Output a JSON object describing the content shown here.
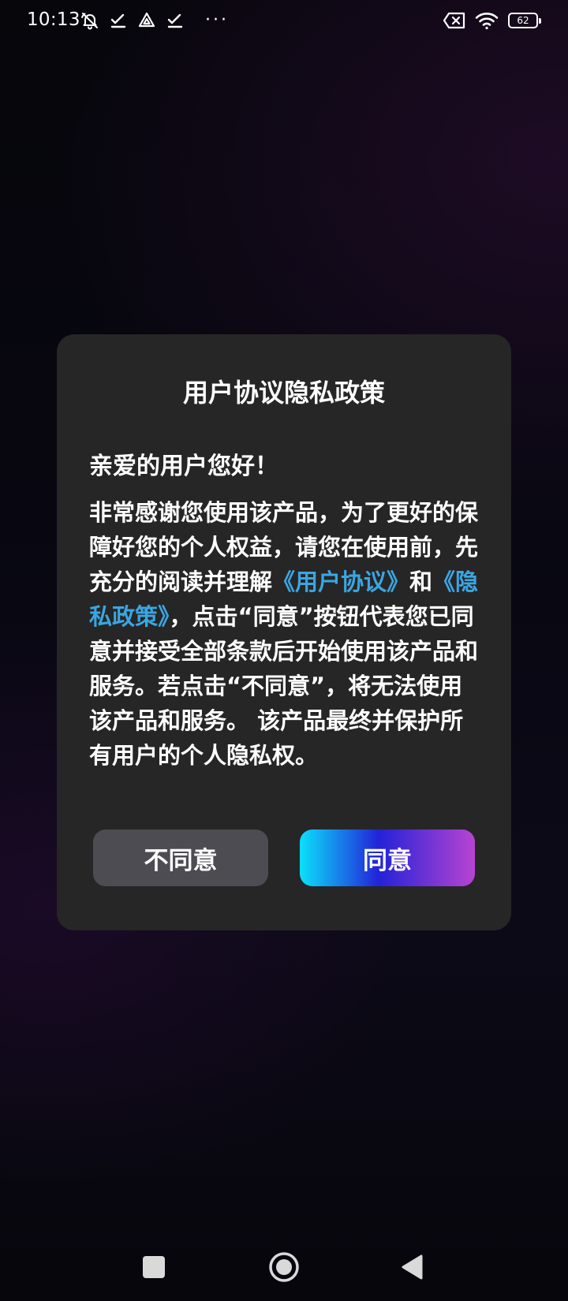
{
  "status_bar": {
    "time": "10:13",
    "more": "···",
    "battery_level": "62",
    "icons_left": [
      "muted-ring-icon",
      "check-icon",
      "cloud-triangle-icon",
      "check-icon"
    ],
    "icons_right": [
      "sim-disabled-icon",
      "wifi-icon",
      "battery-icon"
    ]
  },
  "dialog": {
    "title": "用户协议隐私政策",
    "greeting": "亲爱的用户您好！",
    "message": {
      "part1": "非常感谢您使用该产品，为了更好的保障好您的个人权益，请您在使用前，先充分的阅读并理解",
      "link_user_agreement": "《用户协议》",
      "part2": "和",
      "link_privacy_policy": "《隐私政策》",
      "part3": "，点击“同意”按钮代表您已同意并接受全部条款后开始使用该产品和服务。若点击“不同意”，将无法使用该产品和服务。 该产品最终并保护所有用户的个人隐私权。"
    },
    "disagree_label": "不同意",
    "agree_label": "同意"
  },
  "colors": {
    "dialog_bg": "#262626",
    "link": "#3aa6e3",
    "disagree_bg": "#4d4c52",
    "agree_gradient": [
      "#0be0fb",
      "#2322d8",
      "#b844d1"
    ]
  },
  "nav_bar": {
    "icons": [
      "recents-square-icon",
      "home-circle-icon",
      "back-triangle-icon"
    ]
  }
}
